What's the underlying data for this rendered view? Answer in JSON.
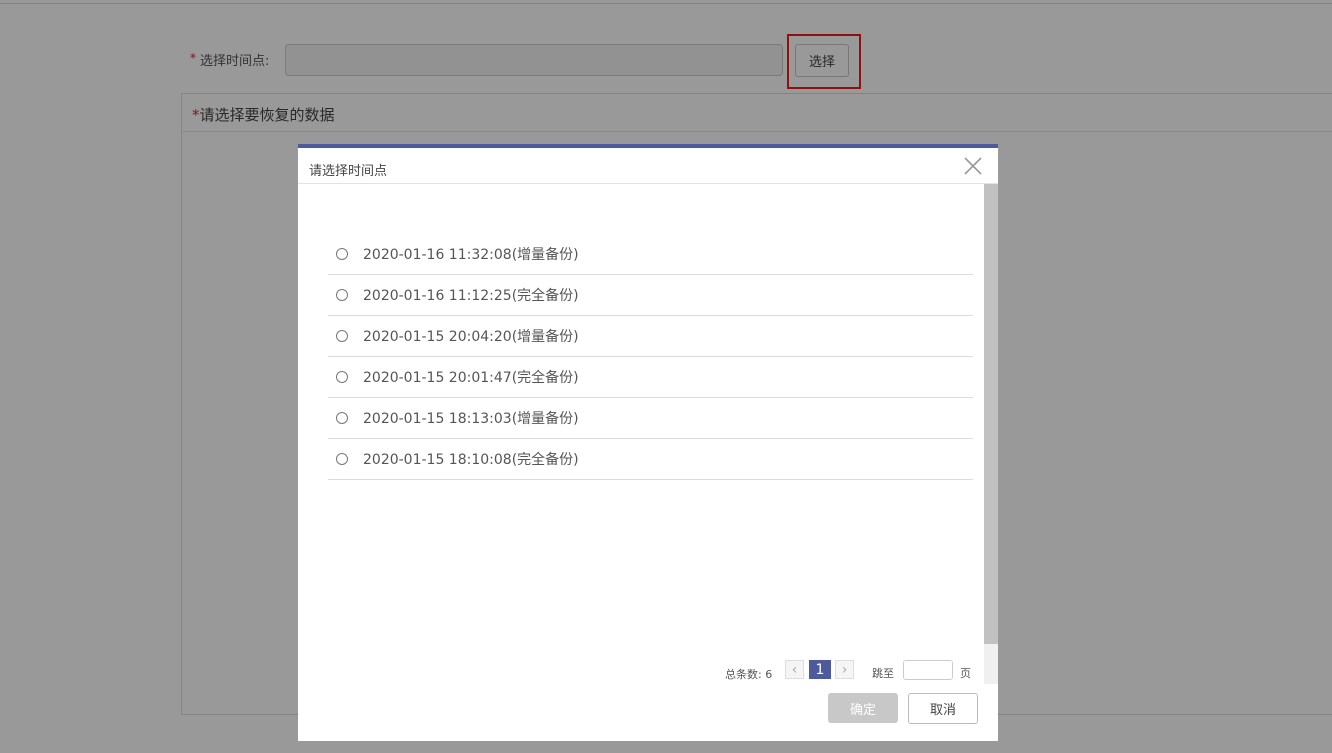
{
  "form": {
    "required_mark": "*",
    "time_label": "选择时间点:",
    "time_value": "",
    "select_button": "选择"
  },
  "data_panel": {
    "required_mark": "*",
    "title": "请选择要恢复的数据"
  },
  "modal": {
    "title": "请选择时间点",
    "accent_color": "#4f5a9c",
    "options": [
      {
        "label": "2020-01-16 11:32:08(增量备份)"
      },
      {
        "label": "2020-01-16 11:12:25(完全备份)"
      },
      {
        "label": "2020-01-15 20:04:20(增量备份)"
      },
      {
        "label": "2020-01-15 20:01:47(完全备份)"
      },
      {
        "label": "2020-01-15 18:13:03(增量备份)"
      },
      {
        "label": "2020-01-15 18:10:08(完全备份)"
      }
    ],
    "pagination": {
      "total_label": "总条数: 6",
      "prev": "‹",
      "current_page": "1",
      "next": "›",
      "jump_label": "跳至",
      "jump_value": "",
      "page_unit": "页"
    },
    "confirm_button": "确定",
    "cancel_button": "取消"
  },
  "highlight_color": "#e8201a"
}
